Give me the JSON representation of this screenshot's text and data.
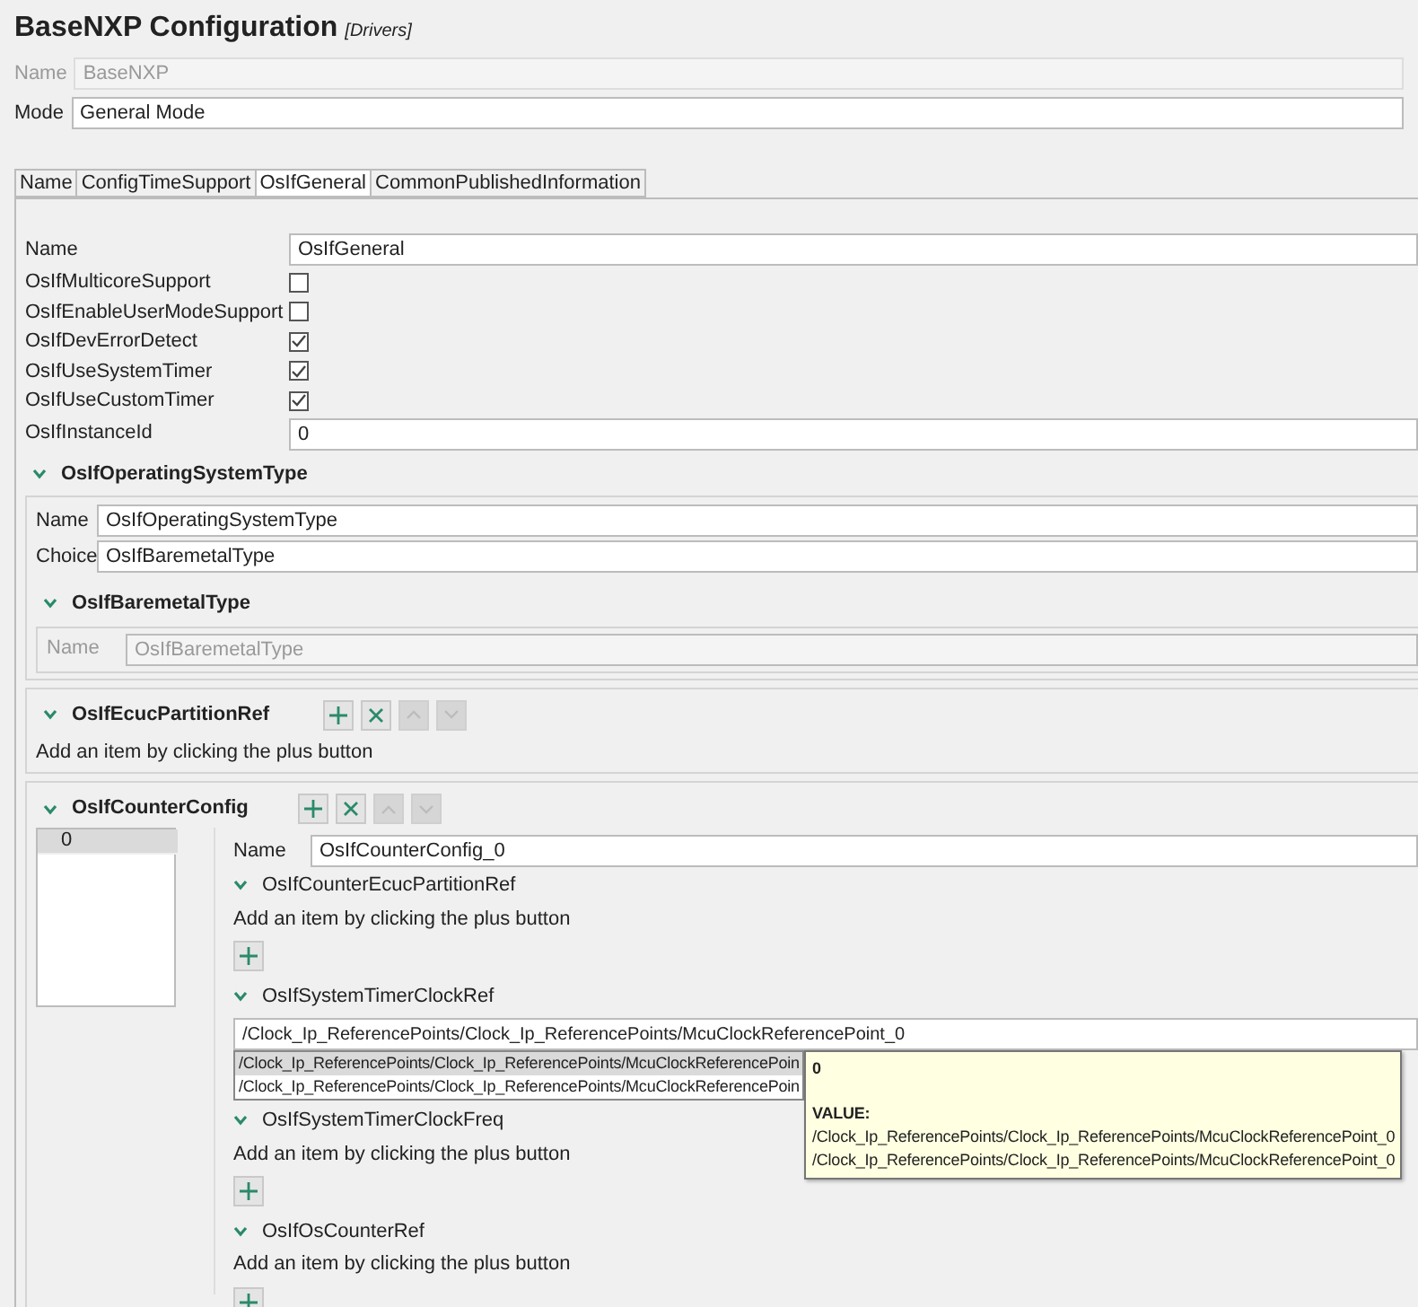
{
  "header": {
    "title": "BaseNXP Configuration",
    "category": "[Drivers]"
  },
  "name_field": {
    "label": "Name",
    "value": "BaseNXP",
    "disabled": true
  },
  "mode_field": {
    "label": "Mode",
    "value": "General Mode",
    "disabled": false
  },
  "tabs": [
    {
      "label": "Name",
      "selected": false
    },
    {
      "label": "ConfigTimeSupport",
      "selected": false
    },
    {
      "label": "OsIfGeneral",
      "selected": true
    },
    {
      "label": "CommonPublishedInformation",
      "selected": false
    }
  ],
  "general": {
    "fields": [
      {
        "kind": "text",
        "label": "Name",
        "value": "OsIfGeneral"
      },
      {
        "kind": "checkbox",
        "label": "OsIfMulticoreSupport",
        "checked": false
      },
      {
        "kind": "checkbox",
        "label": "OsIfEnableUserModeSupport",
        "checked": false
      },
      {
        "kind": "checkbox",
        "label": "OsIfDevErrorDetect",
        "checked": true
      },
      {
        "kind": "checkbox",
        "label": "OsIfUseSystemTimer",
        "checked": true
      },
      {
        "kind": "checkbox",
        "label": "OsIfUseCustomTimer",
        "checked": true
      },
      {
        "kind": "text",
        "label": "OsIfInstanceId",
        "value": "0"
      }
    ]
  },
  "operating_system_type": {
    "title": "OsIfOperatingSystemType",
    "expanded": true,
    "fields": [
      {
        "label": "Name",
        "value": "OsIfOperatingSystemType",
        "disabled": false
      },
      {
        "label": "Choice",
        "value": "OsIfBaremetalType",
        "disabled": false
      }
    ],
    "subsection": {
      "title": "OsIfBaremetalType",
      "expanded": true,
      "fields": [
        {
          "label": "Name",
          "value": "OsIfBaremetalType",
          "disabled": true
        }
      ]
    }
  },
  "ecuc_partition_ref": {
    "title": "OsIfEcucPartitionRef",
    "expanded": true,
    "hint": "Add an item by clicking the plus button",
    "buttons": [
      {
        "kind": "add",
        "disabled": false
      },
      {
        "kind": "remove",
        "disabled": false
      },
      {
        "kind": "up",
        "disabled": true
      },
      {
        "kind": "down",
        "disabled": true
      }
    ]
  },
  "counter_config": {
    "title": "OsIfCounterConfig",
    "expanded": true,
    "buttons": [
      {
        "kind": "add",
        "disabled": false
      },
      {
        "kind": "remove",
        "disabled": false
      },
      {
        "kind": "up",
        "disabled": true
      },
      {
        "kind": "down",
        "disabled": true
      }
    ],
    "items": [
      {
        "label": "0",
        "selected": true
      }
    ],
    "name_field": {
      "label": "Name",
      "value": "OsIfCounterConfig_0"
    },
    "references": [
      {
        "kind": "empty",
        "title": "OsIfCounterEcucPartitionRef",
        "expanded": true,
        "hint": "Add an item by clicking the plus button"
      },
      {
        "kind": "combo",
        "title": "OsIfSystemTimerClockRef",
        "expanded": true,
        "value": "/Clock_Ip_ReferencePoints/Clock_Ip_ReferencePoints/McuClockReferencePoint_0",
        "options": [
          {
            "text": "/Clock_Ip_ReferencePoints/Clock_Ip_ReferencePoints/McuClockReferencePoin",
            "selected": true
          },
          {
            "text": "/Clock_Ip_ReferencePoints/Clock_Ip_ReferencePoints/McuClockReferencePoin",
            "selected": false
          }
        ]
      },
      {
        "kind": "empty",
        "title": "OsIfSystemTimerClockFreq",
        "expanded": true,
        "hint": "Add an item by clicking the plus button"
      },
      {
        "kind": "empty",
        "title": "OsIfOsCounterRef",
        "expanded": true,
        "hint": "Add an item by clicking the plus button"
      }
    ]
  },
  "tooltip": {
    "title": "0",
    "heading": "VALUE:",
    "lines": [
      "/Clock_Ip_ReferencePoints/Clock_Ip_ReferencePoints/McuClockReferencePoint_0",
      "/Clock_Ip_ReferencePoints/Clock_Ip_ReferencePoints/McuClockReferencePoint_0"
    ]
  }
}
